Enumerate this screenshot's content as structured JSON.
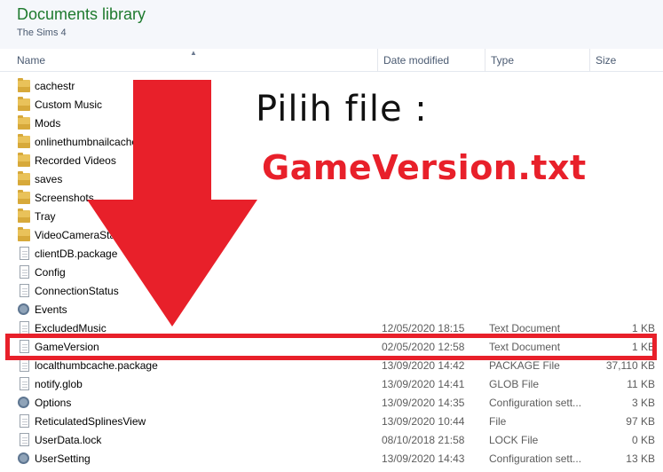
{
  "library": {
    "title": "Documents library",
    "subtitle": "The Sims 4"
  },
  "columns": {
    "name": "Name",
    "date": "Date modified",
    "type": "Type",
    "size": "Size"
  },
  "rows": [
    {
      "name": "cachestr",
      "date": "",
      "type": "",
      "size": "",
      "icon": "folder-icon"
    },
    {
      "name": "Custom Music",
      "date": "",
      "type": "",
      "size": "",
      "icon": "folder-icon"
    },
    {
      "name": "Mods",
      "date": "",
      "type": "",
      "size": "",
      "icon": "folder-icon"
    },
    {
      "name": "onlinethumbnailcache",
      "date": "",
      "type": "",
      "size": "",
      "icon": "folder-icon"
    },
    {
      "name": "Recorded Videos",
      "date": "",
      "type": "",
      "size": "",
      "icon": "folder-icon"
    },
    {
      "name": "saves",
      "date": "",
      "type": "",
      "size": "",
      "icon": "folder-icon"
    },
    {
      "name": "Screenshots",
      "date": "",
      "type": "",
      "size": "",
      "icon": "folder-icon"
    },
    {
      "name": "Tray",
      "date": "",
      "type": "",
      "size": "",
      "icon": "folder-icon"
    },
    {
      "name": "VideoCameraStash",
      "date": "",
      "type": "",
      "size": "",
      "icon": "folder-icon"
    },
    {
      "name": "clientDB.package",
      "date": "",
      "type": "",
      "size": "",
      "icon": "file-icon"
    },
    {
      "name": "Config",
      "date": "",
      "type": "",
      "size": "",
      "icon": "file-icon"
    },
    {
      "name": "ConnectionStatus",
      "date": "",
      "type": "",
      "size": "",
      "icon": "file-icon"
    },
    {
      "name": "Events",
      "date": "",
      "type": "",
      "size": "",
      "icon": "config-file-icon"
    },
    {
      "name": "ExcludedMusic",
      "date": "12/05/2020 18:15",
      "type": "Text Document",
      "size": "1 KB",
      "icon": "file-icon"
    },
    {
      "name": "GameVersion",
      "date": "02/05/2020 12:58",
      "type": "Text Document",
      "size": "1 KB",
      "icon": "file-icon"
    },
    {
      "name": "localthumbcache.package",
      "date": "13/09/2020 14:42",
      "type": "PACKAGE File",
      "size": "37,110 KB",
      "icon": "file-icon"
    },
    {
      "name": "notify.glob",
      "date": "13/09/2020 14:41",
      "type": "GLOB File",
      "size": "11 KB",
      "icon": "file-icon"
    },
    {
      "name": "Options",
      "date": "13/09/2020 14:35",
      "type": "Configuration sett...",
      "size": "3 KB",
      "icon": "config-file-icon"
    },
    {
      "name": "ReticulatedSplinesView",
      "date": "13/09/2020 10:44",
      "type": "File",
      "size": "97 KB",
      "icon": "file-icon"
    },
    {
      "name": "UserData.lock",
      "date": "08/10/2018 21:58",
      "type": "LOCK File",
      "size": "0 KB",
      "icon": "file-icon"
    },
    {
      "name": "UserSetting",
      "date": "13/09/2020 14:43",
      "type": "Configuration sett...",
      "size": "13 KB",
      "icon": "config-file-icon"
    }
  ],
  "annotation": {
    "line1": "Pilih file :",
    "line2": "GameVersion.txt",
    "color": "#e8202a"
  }
}
